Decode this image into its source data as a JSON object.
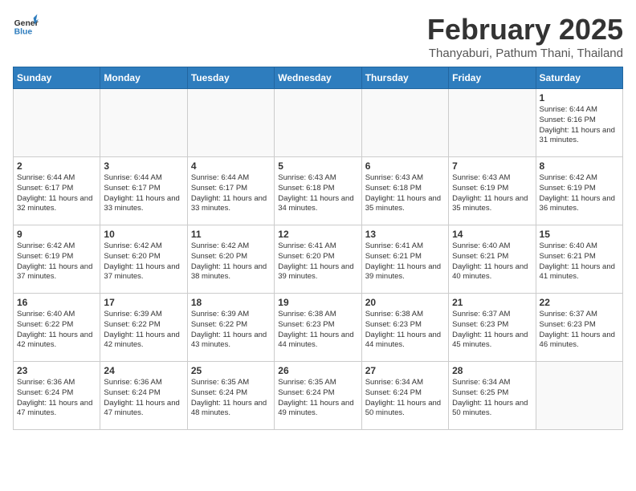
{
  "header": {
    "logo_general": "General",
    "logo_blue": "Blue",
    "month": "February 2025",
    "location": "Thanyaburi, Pathum Thani, Thailand"
  },
  "weekdays": [
    "Sunday",
    "Monday",
    "Tuesday",
    "Wednesday",
    "Thursday",
    "Friday",
    "Saturday"
  ],
  "weeks": [
    [
      {
        "day": "",
        "info": ""
      },
      {
        "day": "",
        "info": ""
      },
      {
        "day": "",
        "info": ""
      },
      {
        "day": "",
        "info": ""
      },
      {
        "day": "",
        "info": ""
      },
      {
        "day": "",
        "info": ""
      },
      {
        "day": "1",
        "info": "Sunrise: 6:44 AM\nSunset: 6:16 PM\nDaylight: 11 hours\nand 31 minutes."
      }
    ],
    [
      {
        "day": "2",
        "info": "Sunrise: 6:44 AM\nSunset: 6:17 PM\nDaylight: 11 hours\nand 32 minutes."
      },
      {
        "day": "3",
        "info": "Sunrise: 6:44 AM\nSunset: 6:17 PM\nDaylight: 11 hours\nand 33 minutes."
      },
      {
        "day": "4",
        "info": "Sunrise: 6:44 AM\nSunset: 6:17 PM\nDaylight: 11 hours\nand 33 minutes."
      },
      {
        "day": "5",
        "info": "Sunrise: 6:43 AM\nSunset: 6:18 PM\nDaylight: 11 hours\nand 34 minutes."
      },
      {
        "day": "6",
        "info": "Sunrise: 6:43 AM\nSunset: 6:18 PM\nDaylight: 11 hours\nand 35 minutes."
      },
      {
        "day": "7",
        "info": "Sunrise: 6:43 AM\nSunset: 6:19 PM\nDaylight: 11 hours\nand 35 minutes."
      },
      {
        "day": "8",
        "info": "Sunrise: 6:42 AM\nSunset: 6:19 PM\nDaylight: 11 hours\nand 36 minutes."
      }
    ],
    [
      {
        "day": "9",
        "info": "Sunrise: 6:42 AM\nSunset: 6:19 PM\nDaylight: 11 hours\nand 37 minutes."
      },
      {
        "day": "10",
        "info": "Sunrise: 6:42 AM\nSunset: 6:20 PM\nDaylight: 11 hours\nand 37 minutes."
      },
      {
        "day": "11",
        "info": "Sunrise: 6:42 AM\nSunset: 6:20 PM\nDaylight: 11 hours\nand 38 minutes."
      },
      {
        "day": "12",
        "info": "Sunrise: 6:41 AM\nSunset: 6:20 PM\nDaylight: 11 hours\nand 39 minutes."
      },
      {
        "day": "13",
        "info": "Sunrise: 6:41 AM\nSunset: 6:21 PM\nDaylight: 11 hours\nand 39 minutes."
      },
      {
        "day": "14",
        "info": "Sunrise: 6:40 AM\nSunset: 6:21 PM\nDaylight: 11 hours\nand 40 minutes."
      },
      {
        "day": "15",
        "info": "Sunrise: 6:40 AM\nSunset: 6:21 PM\nDaylight: 11 hours\nand 41 minutes."
      }
    ],
    [
      {
        "day": "16",
        "info": "Sunrise: 6:40 AM\nSunset: 6:22 PM\nDaylight: 11 hours\nand 42 minutes."
      },
      {
        "day": "17",
        "info": "Sunrise: 6:39 AM\nSunset: 6:22 PM\nDaylight: 11 hours\nand 42 minutes."
      },
      {
        "day": "18",
        "info": "Sunrise: 6:39 AM\nSunset: 6:22 PM\nDaylight: 11 hours\nand 43 minutes."
      },
      {
        "day": "19",
        "info": "Sunrise: 6:38 AM\nSunset: 6:23 PM\nDaylight: 11 hours\nand 44 minutes."
      },
      {
        "day": "20",
        "info": "Sunrise: 6:38 AM\nSunset: 6:23 PM\nDaylight: 11 hours\nand 44 minutes."
      },
      {
        "day": "21",
        "info": "Sunrise: 6:37 AM\nSunset: 6:23 PM\nDaylight: 11 hours\nand 45 minutes."
      },
      {
        "day": "22",
        "info": "Sunrise: 6:37 AM\nSunset: 6:23 PM\nDaylight: 11 hours\nand 46 minutes."
      }
    ],
    [
      {
        "day": "23",
        "info": "Sunrise: 6:36 AM\nSunset: 6:24 PM\nDaylight: 11 hours\nand 47 minutes."
      },
      {
        "day": "24",
        "info": "Sunrise: 6:36 AM\nSunset: 6:24 PM\nDaylight: 11 hours\nand 47 minutes."
      },
      {
        "day": "25",
        "info": "Sunrise: 6:35 AM\nSunset: 6:24 PM\nDaylight: 11 hours\nand 48 minutes."
      },
      {
        "day": "26",
        "info": "Sunrise: 6:35 AM\nSunset: 6:24 PM\nDaylight: 11 hours\nand 49 minutes."
      },
      {
        "day": "27",
        "info": "Sunrise: 6:34 AM\nSunset: 6:24 PM\nDaylight: 11 hours\nand 50 minutes."
      },
      {
        "day": "28",
        "info": "Sunrise: 6:34 AM\nSunset: 6:25 PM\nDaylight: 11 hours\nand 50 minutes."
      },
      {
        "day": "",
        "info": ""
      }
    ]
  ]
}
